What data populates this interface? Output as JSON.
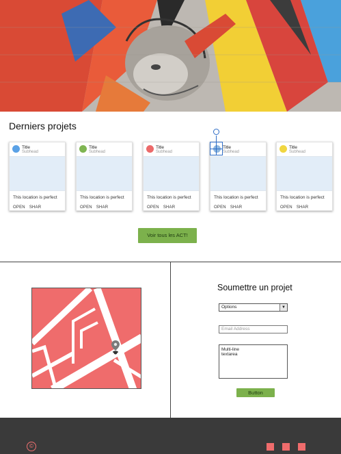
{
  "hero": {
    "image": "street-art mural"
  },
  "projects": {
    "title": "Derniers projets",
    "cards": [
      {
        "title": "Title",
        "subhead": "Subhead",
        "avatar_color": "#5aa1e6",
        "text": "This location is perfect",
        "actions": [
          "OPEN",
          "SHAR"
        ]
      },
      {
        "title": "Title",
        "subhead": "Subhead",
        "avatar_color": "#7fb552",
        "text": "This location is perfect",
        "actions": [
          "OPEN",
          "SHAR"
        ]
      },
      {
        "title": "Title",
        "subhead": "Subhead",
        "avatar_color": "#ec6a6a",
        "text": "This location is perfect",
        "actions": [
          "OPEN",
          "SHAR"
        ]
      },
      {
        "title": "Title",
        "subhead": "Subhead",
        "avatar_color": "#8fb7df",
        "text": "This location is perfect",
        "actions": [
          "OPEN",
          "SHAR"
        ]
      },
      {
        "title": "Title",
        "subhead": "Subhead",
        "avatar_color": "#f0d640",
        "text": "This location is perfect",
        "actions": [
          "OPEN",
          "SHAR"
        ]
      }
    ],
    "see_all_label": "Voir tous les ACT!"
  },
  "form": {
    "title": "Soumettre un projet",
    "select_value": "Options",
    "email_placeholder": "Email Address",
    "textarea_value": "Multi-line\ntextarea",
    "submit_label": "Button"
  },
  "footer": {
    "copyright_symbol": "©",
    "social_count": 3,
    "accent": "#ef6c6c"
  },
  "colors": {
    "accent_green": "#7cb14c",
    "map_red": "#ef6c6c",
    "selection_blue": "#2d6cc6"
  }
}
